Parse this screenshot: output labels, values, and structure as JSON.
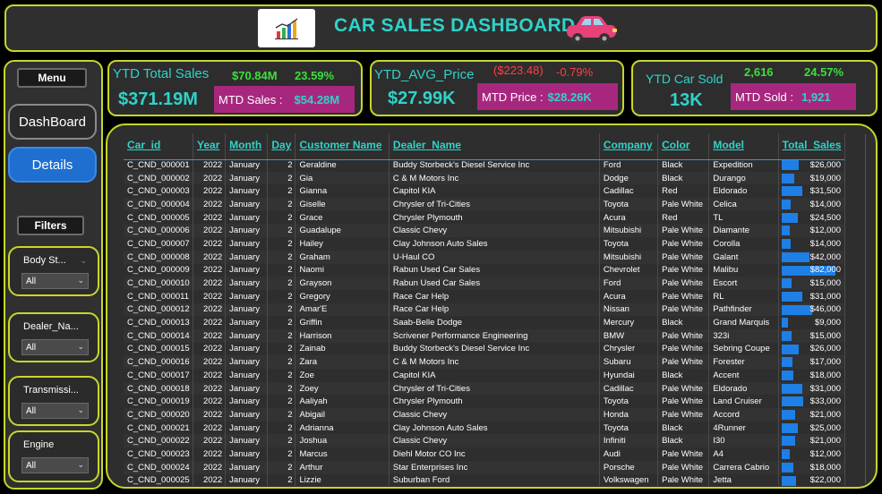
{
  "header": {
    "title": "CAR SALES DASHBOARD"
  },
  "sidebar": {
    "menu_label": "Menu",
    "dashboard_label": "DashBoard",
    "details_label": "Details",
    "filters_label": "Filters",
    "filters": [
      {
        "label": "Body St...",
        "value": "All"
      },
      {
        "label": "Dealer_Na...",
        "value": "All"
      },
      {
        "label": "Transmissi...",
        "value": "All"
      },
      {
        "label": "Engine",
        "value": "All"
      }
    ]
  },
  "kpis": {
    "sales": {
      "label": "YTD Total Sales",
      "value": "$371.19M",
      "change_amount": "$70.84M",
      "change_pct": "23.59%",
      "mtd_label": "MTD Sales :",
      "mtd_value": "$54.28M"
    },
    "price": {
      "label": "YTD_AVG_Price",
      "value": "$27.99K",
      "change_amount": "($223.48)",
      "change_pct": "-0.79%",
      "mtd_label": "MTD Price :",
      "mtd_value": "$28.26K"
    },
    "sold": {
      "label": "YTD Car Sold",
      "value": "13K",
      "change_amount": "2,616",
      "change_pct": "24.57%",
      "mtd_label": "MTD Sold :",
      "mtd_value": "1,921"
    }
  },
  "colors": {
    "accent": "#2fd3c9",
    "border": "#c8d62b",
    "mtd_bg": "#a7277f",
    "bar": "#1e7fe6",
    "positive": "#3be03b",
    "negative": "#ff4040"
  },
  "table": {
    "columns": [
      "Car_id",
      "Year",
      "Month",
      "Day",
      "Customer Name",
      "Dealer_Name",
      "Company",
      "Color",
      "Model",
      "Total_Sales"
    ],
    "bar_max": 82000,
    "rows": [
      [
        "C_CND_000001",
        "2022",
        "January",
        "2",
        "Geraldine",
        "Buddy Storbeck's Diesel Service Inc",
        "Ford",
        "Black",
        "Expedition",
        "$26,000",
        26000
      ],
      [
        "C_CND_000002",
        "2022",
        "January",
        "2",
        "Gia",
        "C & M Motors Inc",
        "Dodge",
        "Black",
        "Durango",
        "$19,000",
        19000
      ],
      [
        "C_CND_000003",
        "2022",
        "January",
        "2",
        "Gianna",
        "Capitol KIA",
        "Cadillac",
        "Red",
        "Eldorado",
        "$31,500",
        31500
      ],
      [
        "C_CND_000004",
        "2022",
        "January",
        "2",
        "Giselle",
        "Chrysler of Tri-Cities",
        "Toyota",
        "Pale White",
        "Celica",
        "$14,000",
        14000
      ],
      [
        "C_CND_000005",
        "2022",
        "January",
        "2",
        "Grace",
        "Chrysler Plymouth",
        "Acura",
        "Red",
        "TL",
        "$24,500",
        24500
      ],
      [
        "C_CND_000006",
        "2022",
        "January",
        "2",
        "Guadalupe",
        "Classic Chevy",
        "Mitsubishi",
        "Pale White",
        "Diamante",
        "$12,000",
        12000
      ],
      [
        "C_CND_000007",
        "2022",
        "January",
        "2",
        "Hailey",
        "Clay Johnson Auto Sales",
        "Toyota",
        "Pale White",
        "Corolla",
        "$14,000",
        14000
      ],
      [
        "C_CND_000008",
        "2022",
        "January",
        "2",
        "Graham",
        "U-Haul CO",
        "Mitsubishi",
        "Pale White",
        "Galant",
        "$42,000",
        42000
      ],
      [
        "C_CND_000009",
        "2022",
        "January",
        "2",
        "Naomi",
        "Rabun Used Car Sales",
        "Chevrolet",
        "Pale White",
        "Malibu",
        "$82,000",
        82000
      ],
      [
        "C_CND_000010",
        "2022",
        "January",
        "2",
        "Grayson",
        "Rabun Used Car Sales",
        "Ford",
        "Pale White",
        "Escort",
        "$15,000",
        15000
      ],
      [
        "C_CND_000011",
        "2022",
        "January",
        "2",
        "Gregory",
        "Race Car Help",
        "Acura",
        "Pale White",
        "RL",
        "$31,000",
        31000
      ],
      [
        "C_CND_000012",
        "2022",
        "January",
        "2",
        "Amar'E",
        "Race Car Help",
        "Nissan",
        "Pale White",
        "Pathfinder",
        "$46,000",
        46000
      ],
      [
        "C_CND_000013",
        "2022",
        "January",
        "2",
        "Griffin",
        "Saab-Belle Dodge",
        "Mercury",
        "Black",
        "Grand Marquis",
        "$9,000",
        9000
      ],
      [
        "C_CND_000014",
        "2022",
        "January",
        "2",
        "Harrison",
        "Scrivener Performance Engineering",
        "BMW",
        "Pale White",
        "323i",
        "$15,000",
        15000
      ],
      [
        "C_CND_000015",
        "2022",
        "January",
        "2",
        "Zainab",
        "Buddy Storbeck's Diesel Service Inc",
        "Chrysler",
        "Pale White",
        "Sebring Coupe",
        "$26,000",
        26000
      ],
      [
        "C_CND_000016",
        "2022",
        "January",
        "2",
        "Zara",
        "C & M Motors Inc",
        "Subaru",
        "Pale White",
        "Forester",
        "$17,000",
        17000
      ],
      [
        "C_CND_000017",
        "2022",
        "January",
        "2",
        "Zoe",
        "Capitol KIA",
        "Hyundai",
        "Black",
        "Accent",
        "$18,000",
        18000
      ],
      [
        "C_CND_000018",
        "2022",
        "January",
        "2",
        "Zoey",
        "Chrysler of Tri-Cities",
        "Cadillac",
        "Pale White",
        "Eldorado",
        "$31,000",
        31000
      ],
      [
        "C_CND_000019",
        "2022",
        "January",
        "2",
        "Aaliyah",
        "Chrysler Plymouth",
        "Toyota",
        "Pale White",
        "Land Cruiser",
        "$33,000",
        33000
      ],
      [
        "C_CND_000020",
        "2022",
        "January",
        "2",
        "Abigail",
        "Classic Chevy",
        "Honda",
        "Pale White",
        "Accord",
        "$21,000",
        21000
      ],
      [
        "C_CND_000021",
        "2022",
        "January",
        "2",
        "Adrianna",
        "Clay Johnson Auto Sales",
        "Toyota",
        "Black",
        "4Runner",
        "$25,000",
        25000
      ],
      [
        "C_CND_000022",
        "2022",
        "January",
        "2",
        "Joshua",
        "Classic Chevy",
        "Infiniti",
        "Black",
        "I30",
        "$21,000",
        21000
      ],
      [
        "C_CND_000023",
        "2022",
        "January",
        "2",
        "Marcus",
        "Diehl Motor CO Inc",
        "Audi",
        "Pale White",
        "A4",
        "$12,000",
        12000
      ],
      [
        "C_CND_000024",
        "2022",
        "January",
        "2",
        "Arthur",
        "Star Enterprises Inc",
        "Porsche",
        "Pale White",
        "Carrera Cabrio",
        "$18,000",
        18000
      ],
      [
        "C_CND_000025",
        "2022",
        "January",
        "2",
        "Lizzie",
        "Suburban Ford",
        "Volkswagen",
        "Pale White",
        "Jetta",
        "$22,000",
        22000
      ]
    ]
  }
}
